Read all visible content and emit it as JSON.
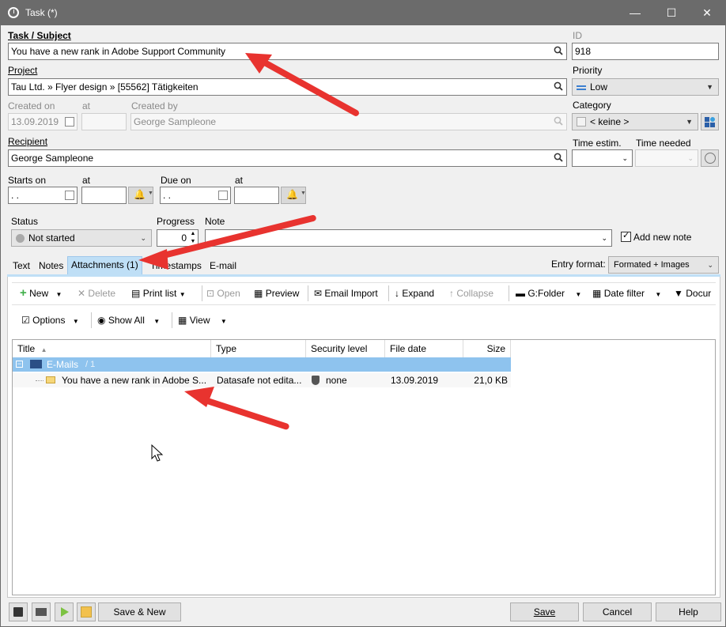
{
  "window": {
    "title": "Task (*)",
    "minimize": "—",
    "maximize": "☐",
    "close": "✕"
  },
  "labels": {
    "task_subject": "Task / Subject",
    "id": "ID",
    "project": "Project",
    "priority": "Priority",
    "created_on": "Created on",
    "created_at": "at",
    "created_by": "Created by",
    "category": "Category",
    "recipient": "Recipient",
    "time_estim": "Time estim.",
    "time_needed": "Time needed",
    "starts_on": "Starts on",
    "starts_at": "at",
    "due_on": "Due on",
    "due_at": "at",
    "status": "Status",
    "progress": "Progress",
    "note": "Note",
    "add_new_note": "Add new note",
    "entry_format": "Entry format:"
  },
  "values": {
    "subject": "You have a new rank in Adobe Support Community",
    "id": "918",
    "project": "Tau Ltd. » Flyer design » [55562] Tätigkeiten",
    "priority": "Low",
    "created_on": "13.09.2019",
    "created_by": "George Sampleone",
    "category": "< keine >",
    "recipient": "George Sampleone",
    "starts_on": " .  .",
    "due_on": " .  .",
    "status": "Not started",
    "progress": "0",
    "entry_format": "Formated + Images",
    "add_new_note_checked": true
  },
  "tabs": [
    "Text",
    "Notes",
    "Attachments (1)",
    "Timestamps",
    "E-mail"
  ],
  "toolbar": {
    "new": "New",
    "delete": "Delete",
    "print_list": "Print list",
    "open": "Open",
    "preview": "Preview",
    "email_import": "Email Import",
    "expand": "Expand",
    "collapse": "Collapse",
    "gfolder": "G:Folder",
    "date_filter": "Date filter",
    "docu": "Docur",
    "options": "Options",
    "show_all": "Show All",
    "view": "View"
  },
  "grid": {
    "columns": [
      "Title",
      "Type",
      "Security level",
      "File date",
      "Size"
    ],
    "group": {
      "name": "E-Mails",
      "count": "/ 1"
    },
    "rows": [
      {
        "title": "You have a new rank in Adobe S...",
        "type": "Datasafe not edita...",
        "security": "none",
        "date": "13.09.2019",
        "size": "21,0 KB"
      }
    ]
  },
  "footer": {
    "save_new": "Save & New",
    "save": "Save",
    "cancel": "Cancel",
    "help": "Help"
  },
  "colors": {
    "titlebar": "#6b6b6b",
    "accent": "#bfdff6",
    "group_row": "#8ec3ee",
    "arrow": "#e8332f"
  }
}
